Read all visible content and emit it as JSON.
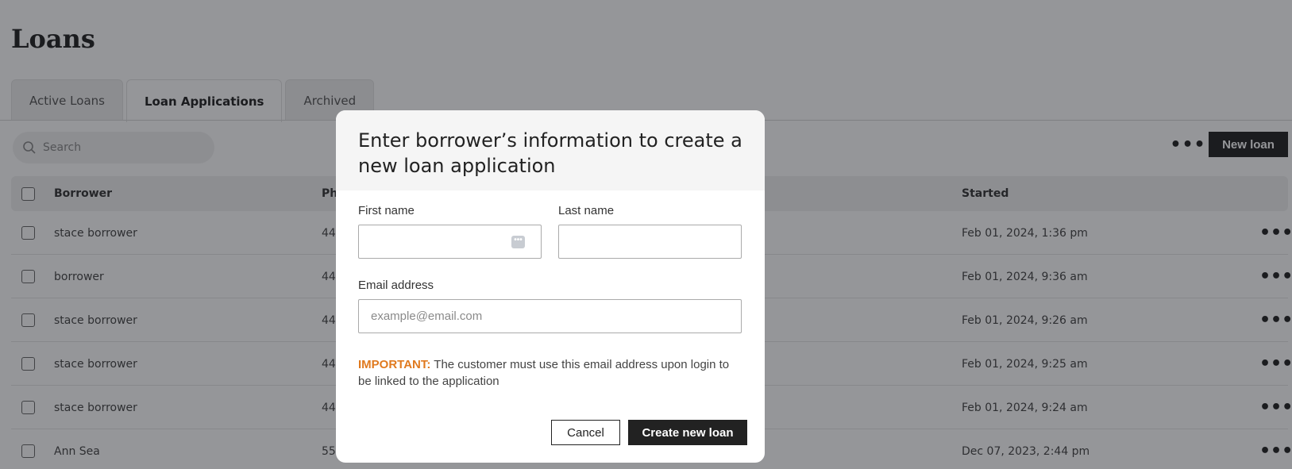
{
  "page": {
    "title": "Loans",
    "tabs": [
      {
        "label": "Active Loans",
        "active": false
      },
      {
        "label": "Loan Applications",
        "active": true
      },
      {
        "label": "Archived",
        "active": false
      }
    ],
    "search": {
      "placeholder": "Search"
    },
    "toolbar": {
      "more_label": "•••",
      "new_loan_label": "New loan"
    }
  },
  "table": {
    "columns": {
      "borrower": "Borrower",
      "phone": "Ph",
      "started": "Started"
    },
    "rows": [
      {
        "borrower": "stace borrower",
        "phone": "44",
        "started": "Feb 01, 2024, 1:36 pm"
      },
      {
        "borrower": "borrower",
        "phone": "44",
        "started": "Feb 01, 2024, 9:36 am"
      },
      {
        "borrower": "stace borrower",
        "phone": "44",
        "started": "Feb 01, 2024, 9:26 am"
      },
      {
        "borrower": "stace borrower",
        "phone": "44",
        "started": "Feb 01, 2024, 9:25 am"
      },
      {
        "borrower": "stace borrower",
        "phone": "44",
        "started": "Feb 01, 2024, 9:24 am"
      },
      {
        "borrower": "Ann Sea",
        "phone": "55",
        "started": "Dec 07, 2023, 2:44 pm"
      }
    ],
    "row_more_label": "•••"
  },
  "modal": {
    "title": "Enter borrower’s information to create a new loan application",
    "first_name_label": "First name",
    "first_name_value": "",
    "last_name_label": "Last name",
    "last_name_value": "",
    "email_label": "Email address",
    "email_placeholder": "example@email.com",
    "notice_important": "IMPORTANT:",
    "notice_text": " The customer must use this email address upon login to be linked to the application",
    "cancel_label": "Cancel",
    "create_label": "Create new loan",
    "autofill_icon_glyph": "•••"
  },
  "colors": {
    "overlay": "#14161c",
    "primary_button": "#222222",
    "important": "#e07a1f"
  }
}
